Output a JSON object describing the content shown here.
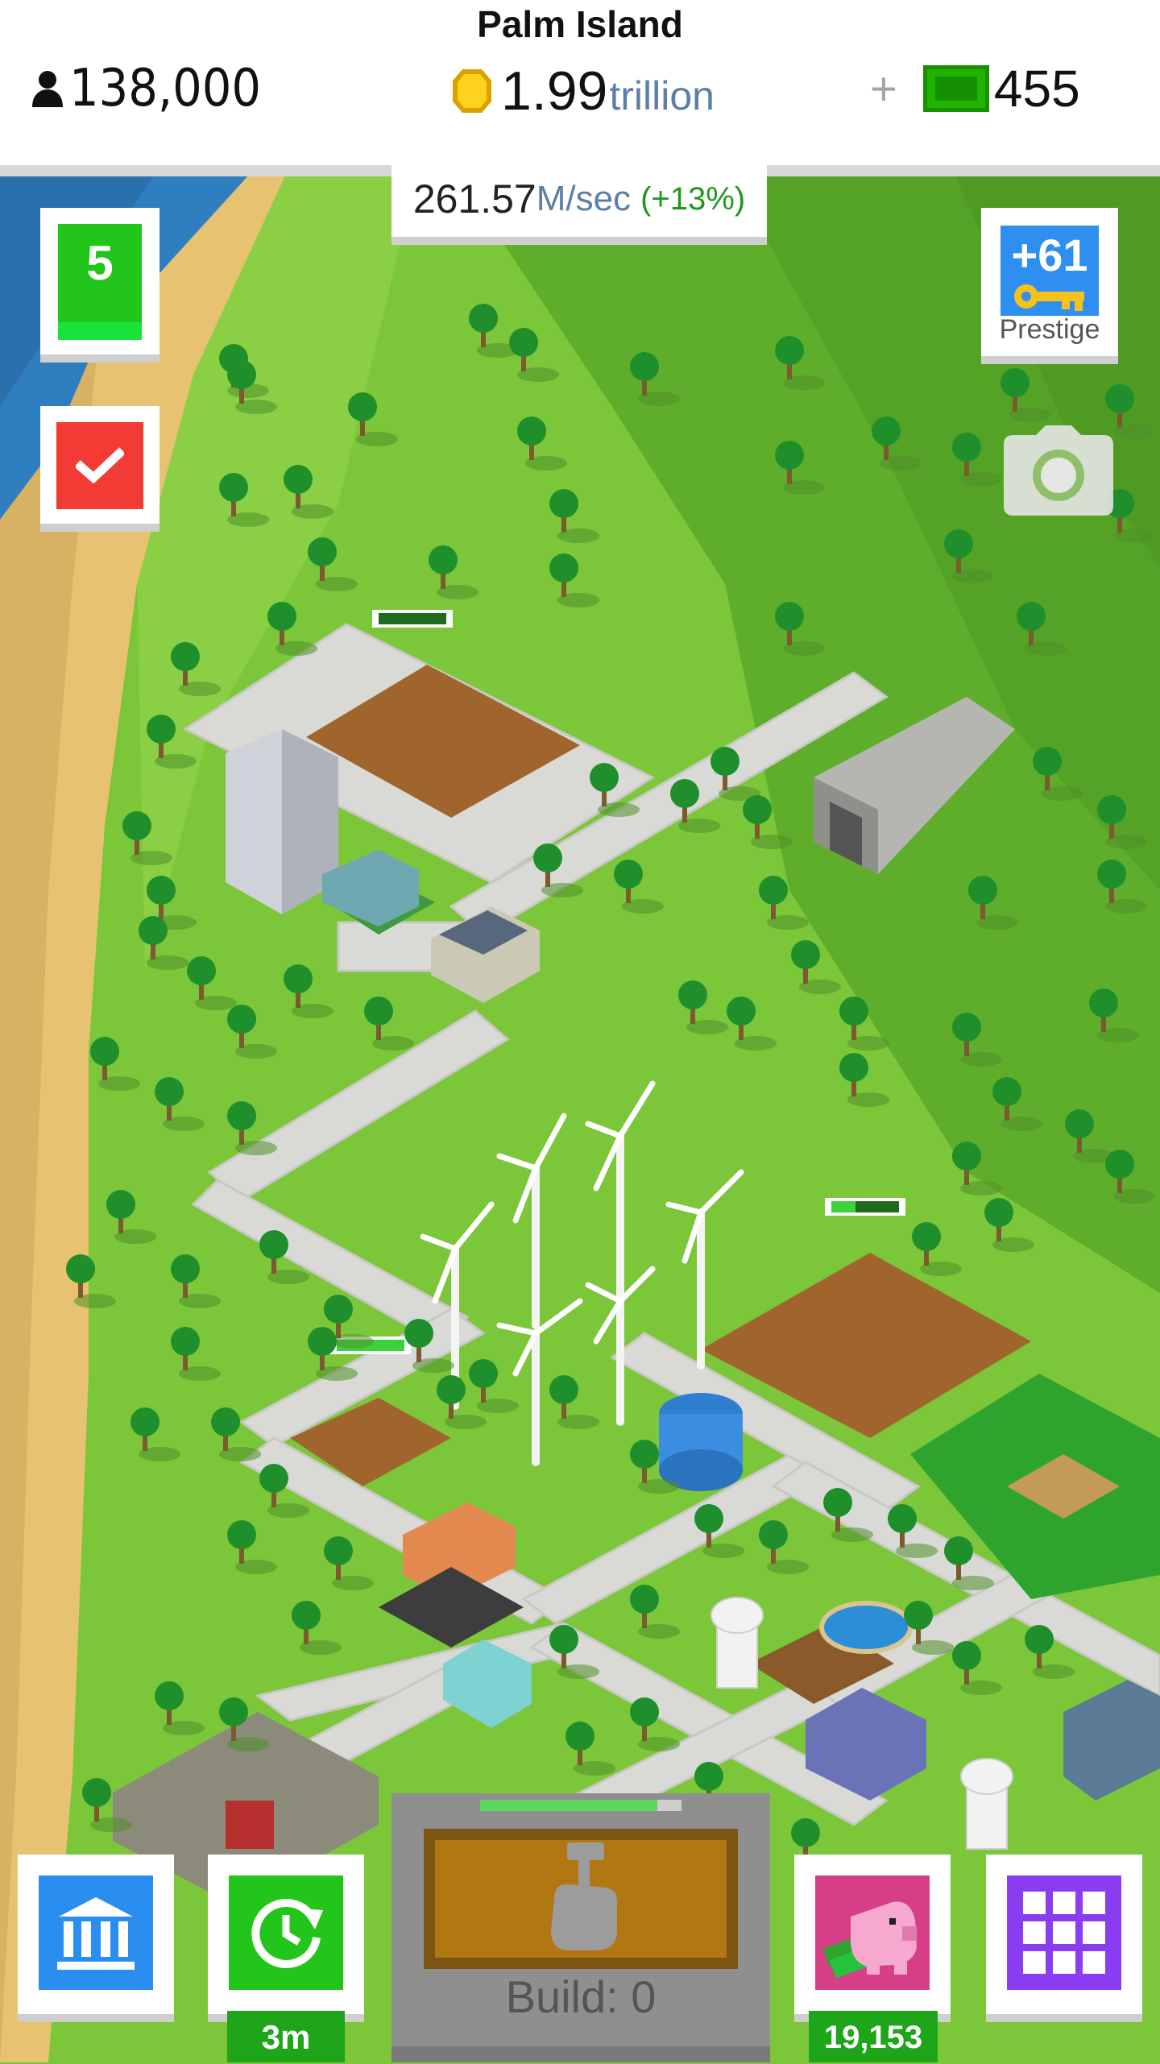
{
  "header": {
    "island_name": "Palm Island",
    "population": "138,000",
    "coins_amount": "1.99",
    "coins_unit": "trillion",
    "cash_plus": "+",
    "cash_amount": "455"
  },
  "income": {
    "value": "261.57",
    "unit": "M/sec",
    "bonus": "(+13%)"
  },
  "sidebar": {
    "level": "5",
    "prestige_count": "+61",
    "prestige_label": "Prestige"
  },
  "bottom": {
    "boost_time": "3m",
    "build_label": "Build: 0",
    "piggy_amount": "19,153"
  },
  "colors": {
    "grass": "#7cc63a",
    "road": "#d9d9d6",
    "dirt": "#a0652c",
    "water": "#2f7fc0",
    "sand": "#e7c271",
    "accent_green": "#22c51a",
    "accent_blue": "#2a8df0",
    "accent_red": "#f23b34",
    "accent_purple": "#8a3cf0",
    "accent_pink": "#d63f88"
  },
  "icons": [
    "person-icon",
    "coin-icon",
    "cash-icon",
    "check-icon",
    "key-icon",
    "camera-icon",
    "bank-icon",
    "clock-refresh-icon",
    "hammer-hand-icon",
    "piggy-bank-icon",
    "grid-icon"
  ]
}
